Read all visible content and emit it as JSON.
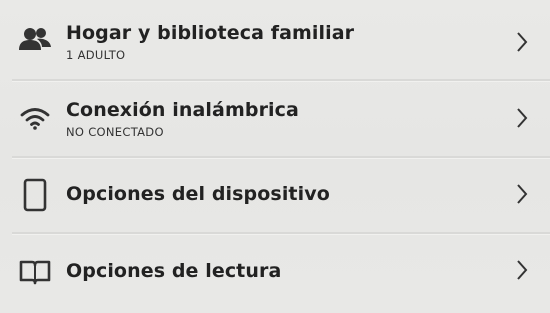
{
  "menu": {
    "items": [
      {
        "title": "Hogar y biblioteca familiar",
        "subtitle": "1 ADULTO",
        "icon": "people-icon"
      },
      {
        "title": "Conexión inalámbrica",
        "subtitle": "NO CONECTADO",
        "icon": "wifi-icon"
      },
      {
        "title": "Opciones del dispositivo",
        "icon": "tablet-icon"
      },
      {
        "title": "Opciones de lectura",
        "icon": "book-icon"
      }
    ]
  },
  "colors": {
    "background": "#e8e8e6",
    "text": "#222222",
    "icon": "#333333"
  }
}
